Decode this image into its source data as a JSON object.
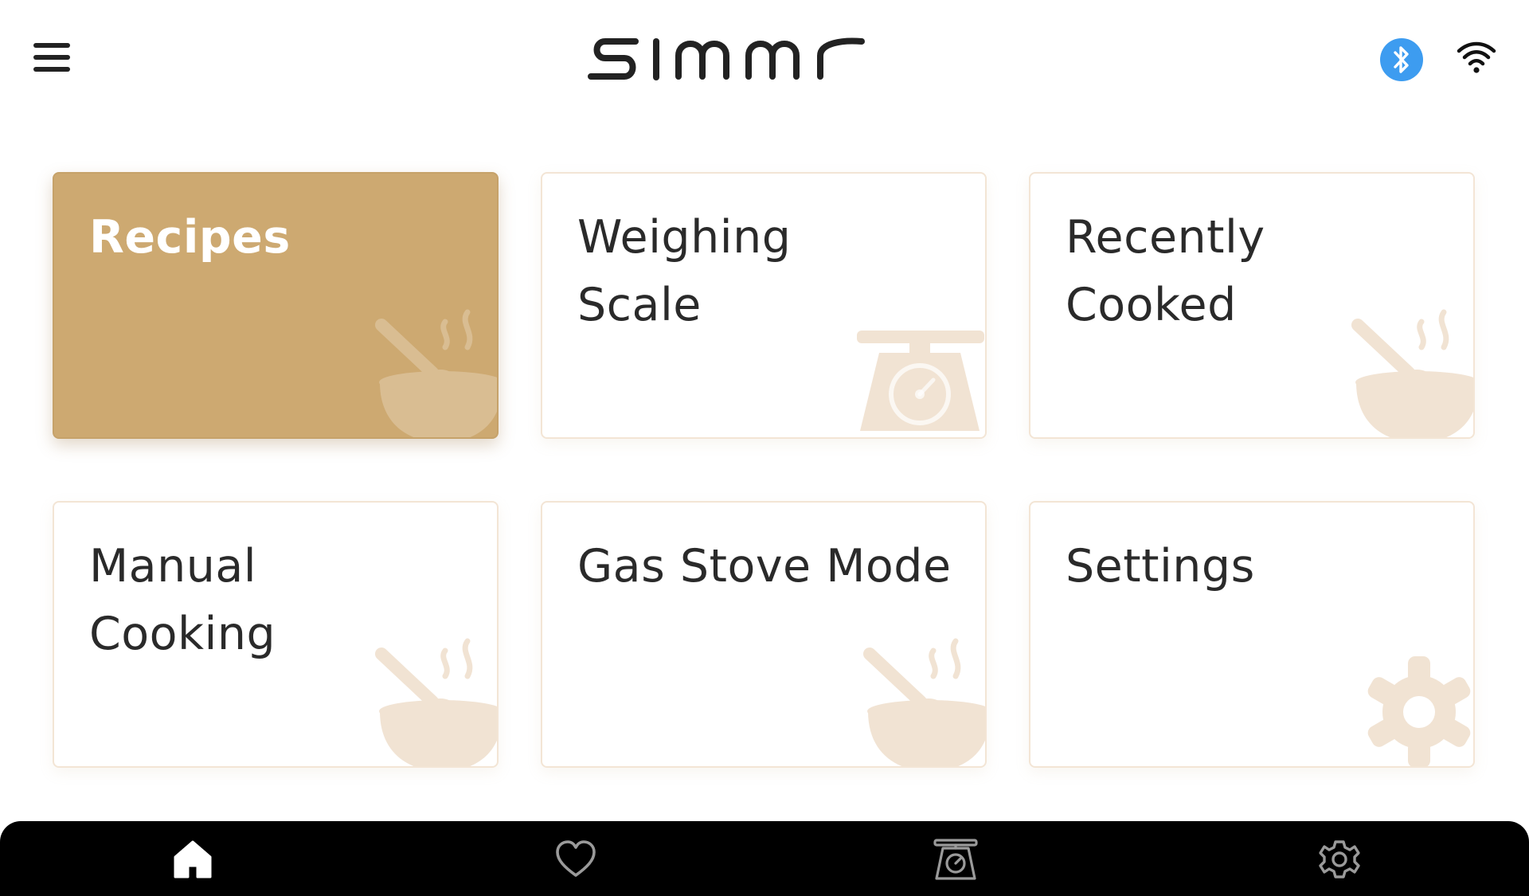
{
  "header": {
    "menu_icon": "hamburger-menu-icon",
    "logo_text": "simmr",
    "bluetooth_icon": "bluetooth-icon",
    "wifi_icon": "wifi-icon",
    "bluetooth_color": "#3d9cf0"
  },
  "tiles": [
    {
      "label": "Recipes",
      "icon": "bowl-steam-icon",
      "selected": true
    },
    {
      "label": "Weighing\nScale",
      "icon": "weighing-scale-icon",
      "selected": false
    },
    {
      "label": "Recently\nCooked",
      "icon": "bowl-steam-icon",
      "selected": false
    },
    {
      "label": "Manual\nCooking",
      "icon": "bowl-steam-icon",
      "selected": false
    },
    {
      "label": "Gas Stove Mode",
      "icon": "bowl-steam-icon",
      "selected": false
    },
    {
      "label": "Settings",
      "icon": "gear-icon",
      "selected": false
    }
  ],
  "bottom_nav": [
    {
      "name": "home",
      "icon": "home-icon",
      "active": true
    },
    {
      "name": "favorites",
      "icon": "heart-icon",
      "active": false
    },
    {
      "name": "scale",
      "icon": "weighing-scale-icon",
      "active": false
    },
    {
      "name": "settings",
      "icon": "gear-icon",
      "active": false
    }
  ],
  "colors": {
    "accent": "#cda971",
    "tile_border": "#f3e5d5",
    "watermark_art": "#f1e3d3",
    "watermark_art_active": "#d9bd92",
    "nav_background": "#000000",
    "text": "#2a2a2a"
  }
}
